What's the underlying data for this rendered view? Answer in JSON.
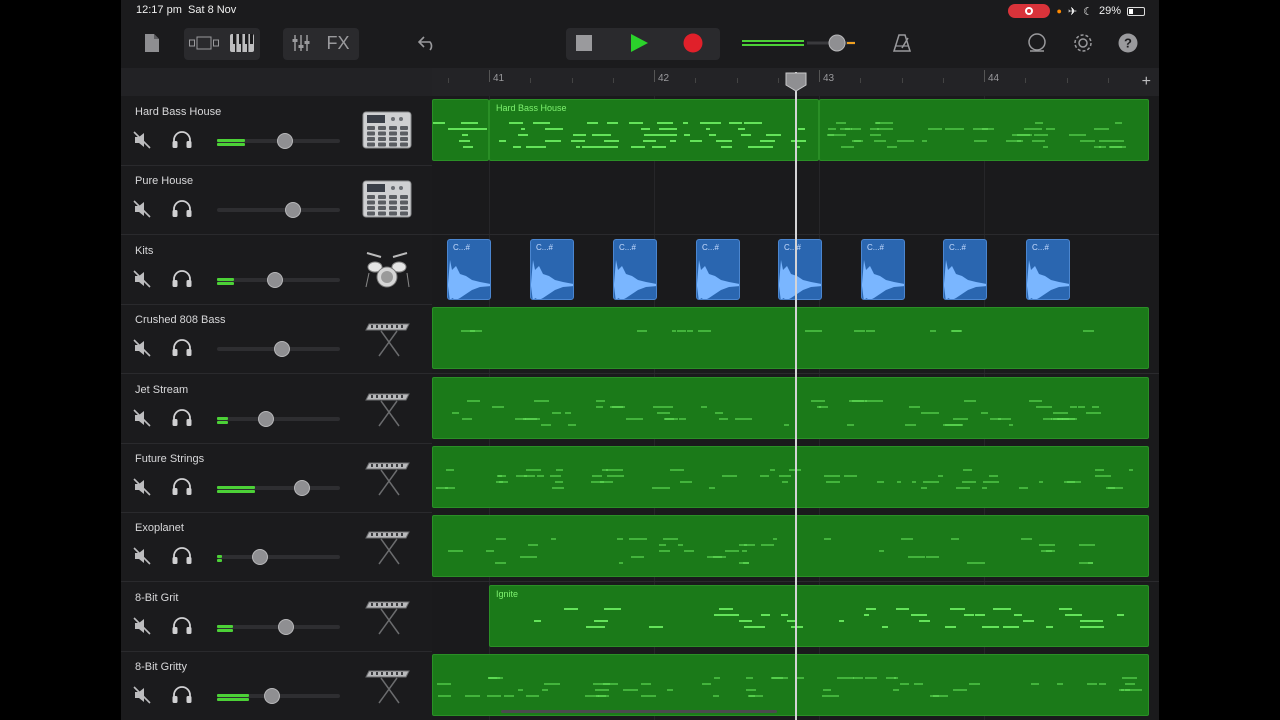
{
  "status": {
    "time": "12:17 pm",
    "date": "Sat 8 Nov",
    "battery": "29%"
  },
  "toolbar": {
    "fx_label": "FX",
    "icons": [
      "document-icon",
      "view-toggle-icon",
      "keyboard-icon",
      "mixer-icon",
      "fx-button",
      "undo-icon",
      "stop-icon",
      "play-icon",
      "record-icon",
      "master-volume",
      "metronome-icon",
      "loop-icon",
      "settings-icon",
      "help-icon"
    ],
    "colors": {
      "play": "#2bd32b",
      "record": "#e0202a",
      "accent": "#4cd137"
    }
  },
  "ruler": {
    "bars": [
      "41",
      "42",
      "43",
      "44"
    ]
  },
  "tracks": [
    {
      "name": "Hard Bass House",
      "volume": 0.55,
      "level": 0.23,
      "instrument": "beat-sequencer-icon"
    },
    {
      "name": "Pure House",
      "volume": 0.62,
      "level": 0.0,
      "instrument": "beat-sequencer-icon"
    },
    {
      "name": "Kits",
      "volume": 0.47,
      "level": 0.14,
      "instrument": "drum-kit-icon"
    },
    {
      "name": "Crushed 808 Bass",
      "volume": 0.53,
      "level": 0.0,
      "instrument": "keyboard-synth-icon"
    },
    {
      "name": "Jet Stream",
      "volume": 0.4,
      "level": 0.09,
      "instrument": "keyboard-synth-icon"
    },
    {
      "name": "Future Strings",
      "volume": 0.69,
      "level": 0.31,
      "instrument": "keyboard-synth-icon"
    },
    {
      "name": "Exoplanet",
      "volume": 0.35,
      "level": 0.04,
      "instrument": "keyboard-synth-icon"
    },
    {
      "name": "8-Bit Grit",
      "volume": 0.56,
      "level": 0.13,
      "instrument": "keyboard-synth-icon"
    },
    {
      "name": "8-Bit Gritty",
      "volume": 0.45,
      "level": 0.26,
      "instrument": "keyboard-synth-icon"
    }
  ],
  "regions": {
    "hard_bass_house_label": "Hard Bass House",
    "ignite_label": "Ignite",
    "audio_label": "C...#"
  }
}
